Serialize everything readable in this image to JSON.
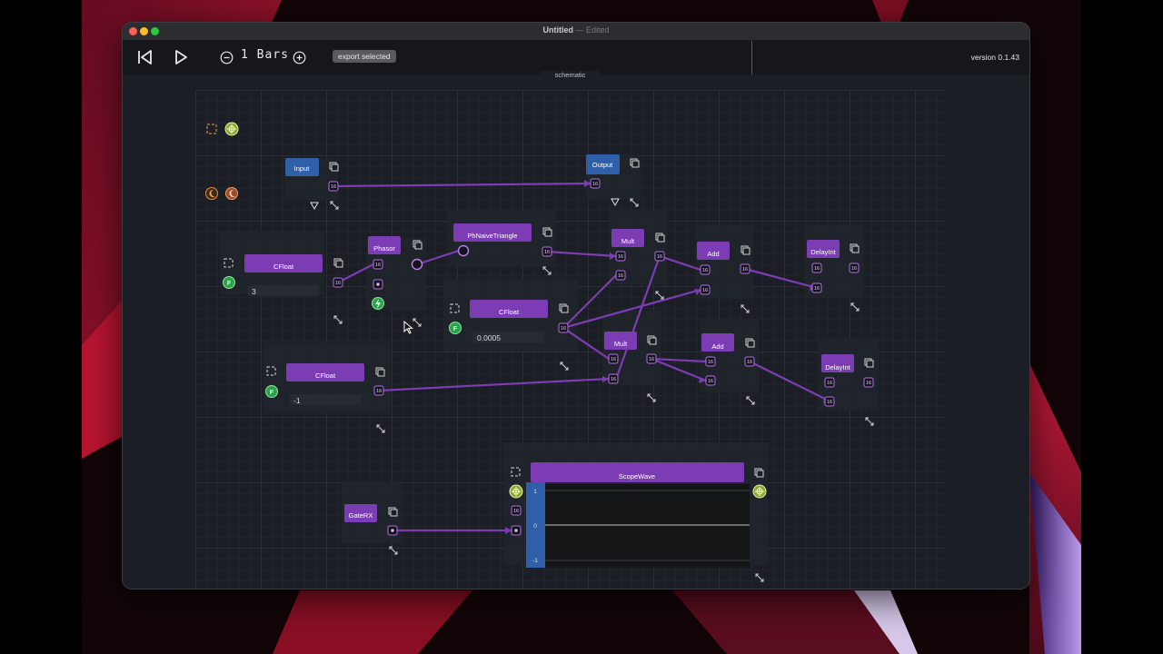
{
  "window": {
    "title": "Untitled",
    "title_sep": " — ",
    "title_state": "Edited",
    "traffic_colors": [
      "#ff5f57",
      "#febc2e",
      "#28c840"
    ]
  },
  "toolbar": {
    "bars_count": "1",
    "bars_unit": "Bars",
    "export_label": "export selected",
    "version": "version 0.1.43",
    "icons": [
      "skip-back-icon",
      "play-icon",
      "minus-circle-icon",
      "plus-circle-icon"
    ]
  },
  "canvas": {
    "title": "schematic",
    "accent": "#7b3cb4",
    "io_accent": "#2e5fa8",
    "port_label": "16"
  },
  "nodes": {
    "input": "Input",
    "output": "Output",
    "phasor": "Phasor",
    "phnaive": "PhNaiveTriangle",
    "cfloat1": "CFloat",
    "cfloat1_value": "3",
    "cfloat2": "CFloat",
    "cfloat2_value": "0.0005",
    "cfloat3": "CFloat",
    "cfloat3_value": "-1",
    "mult1": "Mult",
    "mult2": "Mult",
    "add1": "Add",
    "add2": "Add",
    "delay1": "DelayInt",
    "delay2": "DelayInt",
    "gaterx": "GateRX",
    "scope": "ScopeWave",
    "scope_ticks": [
      "1",
      "0",
      "-1"
    ]
  }
}
